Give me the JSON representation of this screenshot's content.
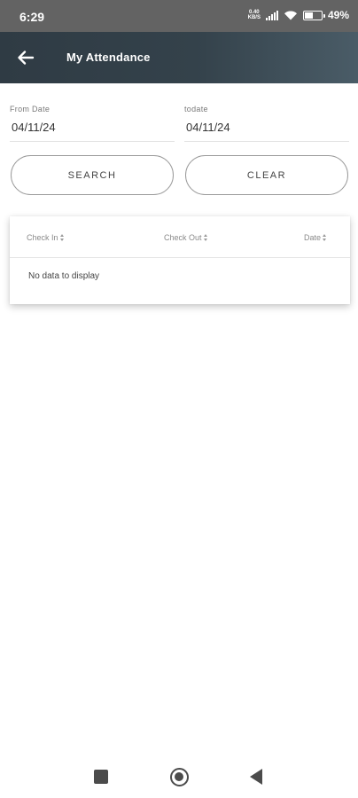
{
  "status_bar": {
    "time": "6:29",
    "net_speed_value": "0.40",
    "net_speed_unit": "KB/S",
    "battery": "49%"
  },
  "app_bar": {
    "title": "My Attendance"
  },
  "form": {
    "from_label": "From Date",
    "from_value": "04/11/24",
    "to_label": "todate",
    "to_value": "04/11/24",
    "search_label": "SEARCH",
    "clear_label": "CLEAR"
  },
  "table": {
    "columns": [
      "Check In",
      "Check Out",
      "Date"
    ],
    "empty_message": "No data to display"
  }
}
